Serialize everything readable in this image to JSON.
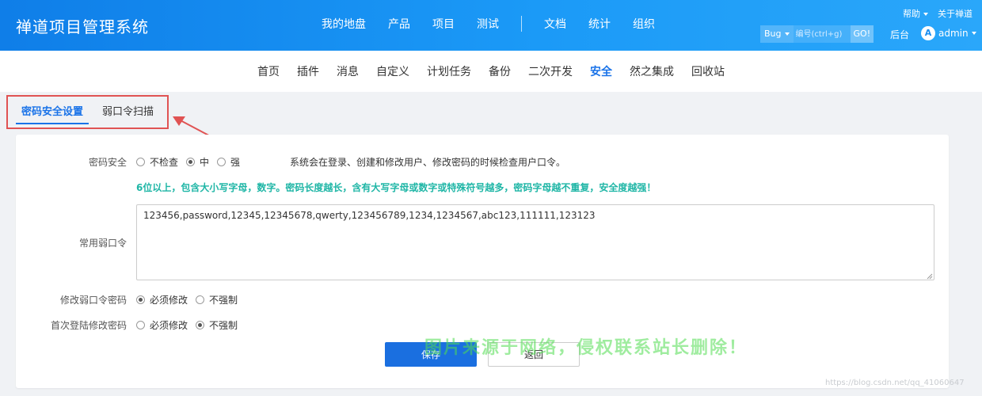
{
  "header": {
    "app_title": "禅道项目管理系统",
    "nav": [
      "我的地盘",
      "产品",
      "项目",
      "测试",
      "文档",
      "统计",
      "组织"
    ],
    "help": "帮助",
    "about": "关于禅道",
    "search": {
      "type": "Bug",
      "placeholder": "编号(ctrl+g)",
      "go": "GO!"
    },
    "backend": "后台",
    "user": {
      "avatar_letter": "A",
      "name": "admin"
    }
  },
  "sub_nav": {
    "items": [
      "首页",
      "插件",
      "消息",
      "自定义",
      "计划任务",
      "备份",
      "二次开发",
      "安全",
      "然之集成",
      "回收站"
    ],
    "active": "安全"
  },
  "tabs": [
    {
      "label": "密码安全设置",
      "active": true
    },
    {
      "label": "弱口令扫描",
      "active": false
    }
  ],
  "form": {
    "password_security": {
      "label": "密码安全",
      "options": [
        "不检查",
        "中",
        "强"
      ],
      "selected": "中",
      "hint": "系统会在登录、创建和修改用户、修改密码的时候检查用户口令。",
      "strength_tip": "6位以上，包含大小写字母，数字。密码长度越长，含有大写字母或数字或特殊符号越多，密码字母越不重复，安全度越强！"
    },
    "weak_passwords": {
      "label": "常用弱口令",
      "value": "123456,password,12345,12345678,qwerty,123456789,1234,1234567,abc123,111111,123123"
    },
    "change_weak": {
      "label": "修改弱口令密码",
      "options": [
        "必须修改",
        "不强制"
      ],
      "selected": "必须修改"
    },
    "first_login": {
      "label": "首次登陆修改密码",
      "options": [
        "必须修改",
        "不强制"
      ],
      "selected": "不强制"
    },
    "save_label": "保存",
    "back_label": "返回"
  },
  "watermark": "图片来源于网络，侵权联系站长删除！",
  "blog_mark": "https://blog.csdn.net/qq_41060647",
  "colors": {
    "header": "#1a8ef0",
    "accent": "#1a73e8",
    "tip": "#1fb6a6",
    "highlight": "#e05353"
  }
}
